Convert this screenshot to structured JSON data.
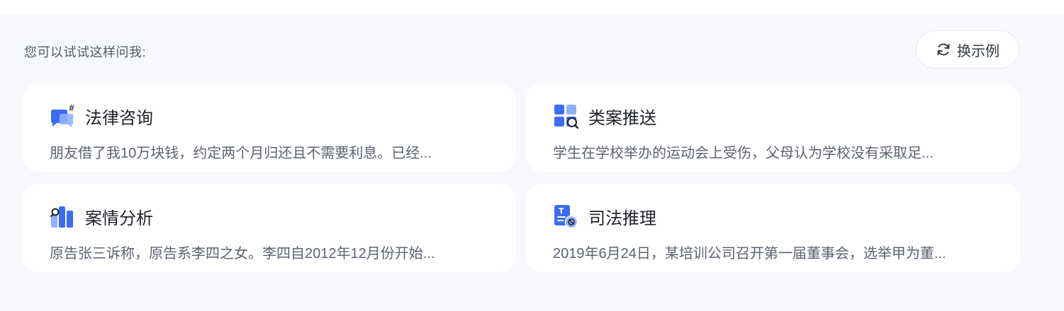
{
  "prompt_title": "您可以试试这样问我:",
  "swap_button": {
    "label": "换示例",
    "icon": "refresh-icon"
  },
  "colors": {
    "accent": "#3d6bf5",
    "accent_light": "#8fb1ff",
    "panel_bg": "#f7f8fc"
  },
  "cards": [
    {
      "title": "法律咨询",
      "icon": "chat-bubble-icon",
      "description": "朋友借了我10万块钱，约定两个月归还且不需要利息。已经..."
    },
    {
      "title": "类案推送",
      "icon": "grid-search-icon",
      "description": "学生在学校举办的运动会上受伤，父母认为学校没有采取足..."
    },
    {
      "title": "案情分析",
      "icon": "bar-chart-icon",
      "description": "原告张三诉称，原告系李四之女。李四自2012年12月份开始..."
    },
    {
      "title": "司法推理",
      "icon": "document-reasoning-icon",
      "description": "2019年6月24日，某培训公司召开第一届董事会，选举甲为董..."
    }
  ]
}
